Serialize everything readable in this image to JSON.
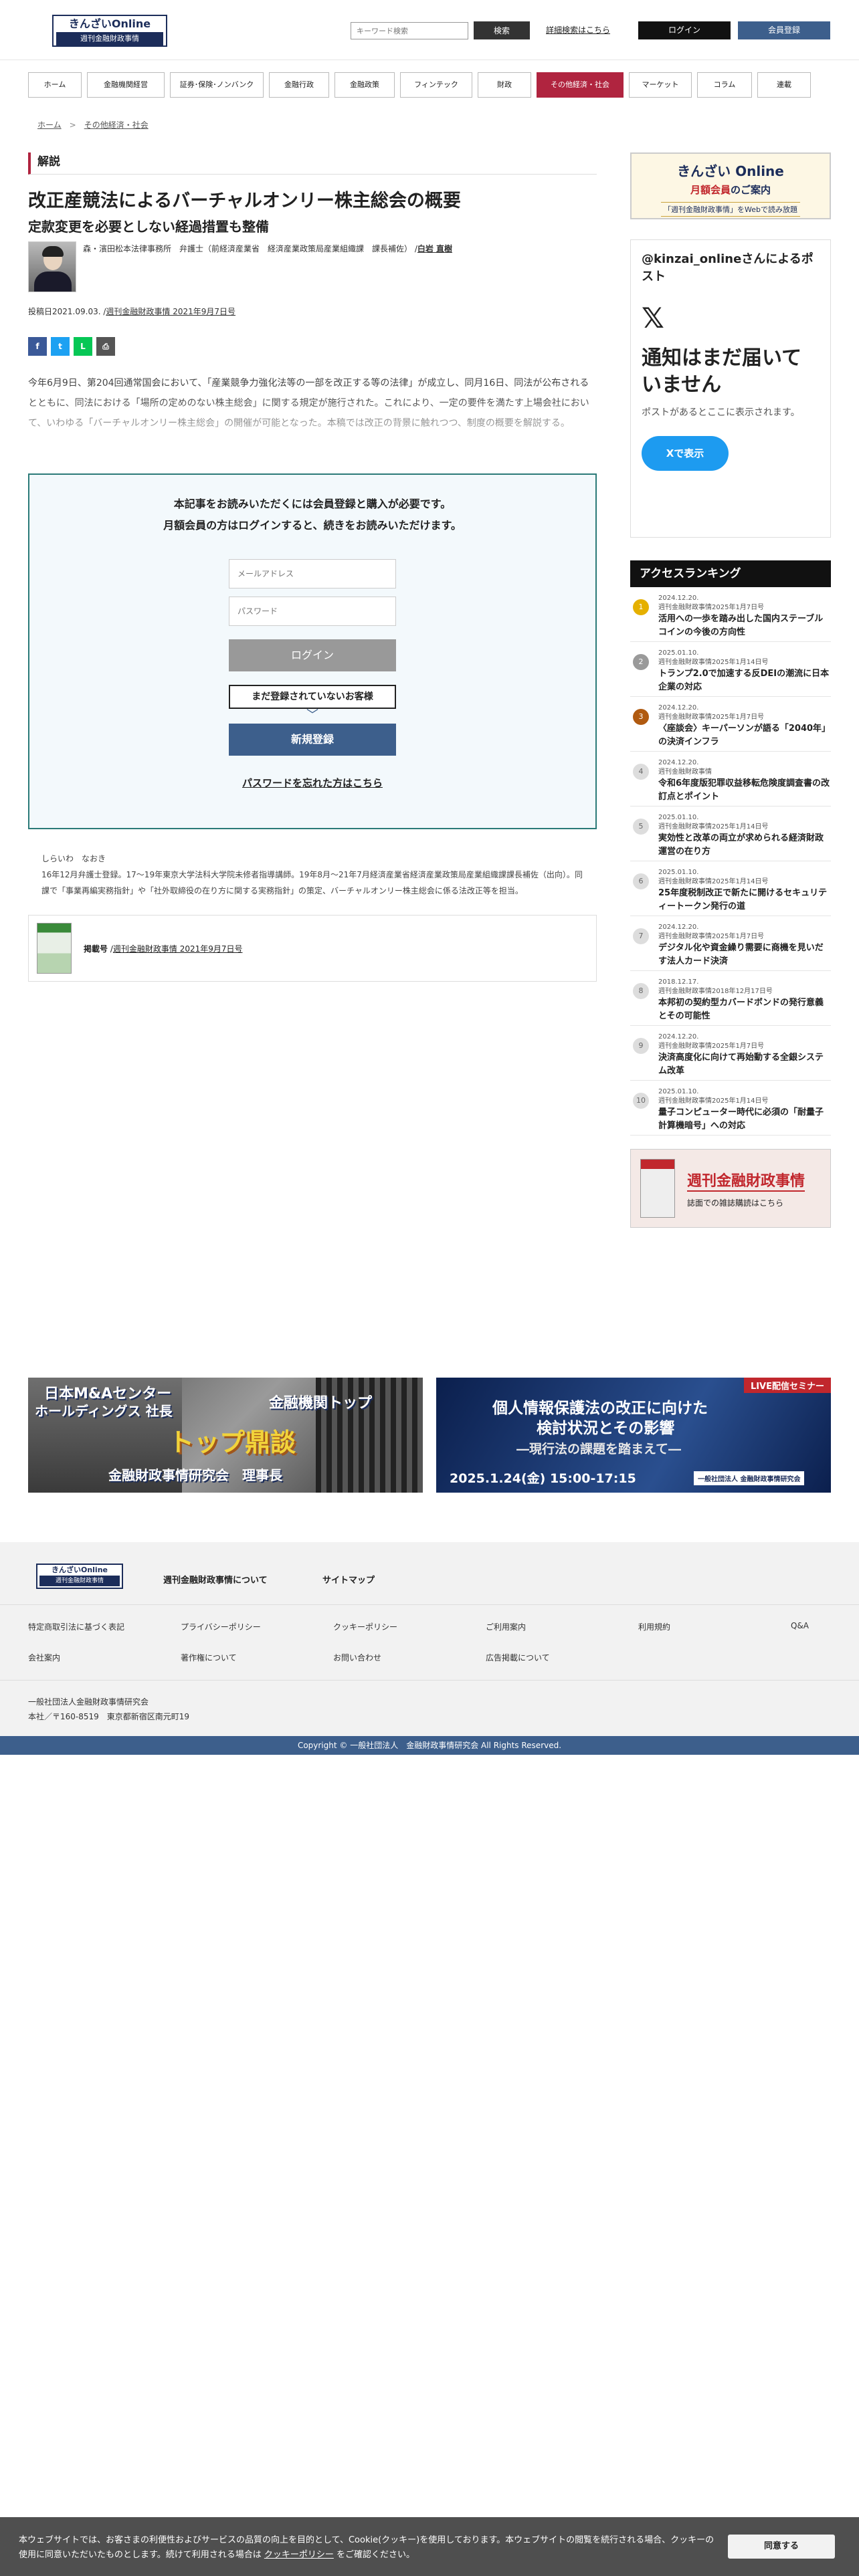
{
  "header": {
    "logo_line1": "きんざいOnline",
    "logo_line2": "週刊金融財政事情",
    "search_placeholder": "キーワード検索",
    "search_button": "検索",
    "advanced_search": "詳細検索はこちら",
    "login": "ログイン",
    "register": "会員登録"
  },
  "nav": {
    "items": [
      {
        "label": "ホーム",
        "w": 80
      },
      {
        "label": "金融機関経営",
        "w": 116
      },
      {
        "label": "証券･保険･ノンバンク",
        "w": 140
      },
      {
        "label": "金融行政",
        "w": 90
      },
      {
        "label": "金融政策",
        "w": 90
      },
      {
        "label": "フィンテック",
        "w": 108
      },
      {
        "label": "財政",
        "w": 80
      },
      {
        "label": "その他経済・社会",
        "w": 130
      },
      {
        "label": "マーケット",
        "w": 94
      },
      {
        "label": "コラム",
        "w": 82
      },
      {
        "label": "連載",
        "w": 80
      }
    ],
    "active_index": 7
  },
  "breadcrumb": {
    "home": "ホーム",
    "current": "その他経済・社会"
  },
  "article": {
    "category": "解説",
    "title": "改正産競法によるバーチャルオンリー株主総会の概要",
    "subtitle": "定款変更を必要としない経過措置も整備",
    "author_affiliation": "森・濱田松本法律事務所　弁護士（前経済産業省　経済産業政策局産業組織課　課長補佐）",
    "author_sep": " /",
    "author_name": "白岩 直樹",
    "posted": "投稿日2021.09.03. /",
    "issue_link": "週刊金融財政事情 2021年9月7日号",
    "body": "今年6月9日、第204回通常国会において、「産業競争力強化法等の一部を改正する等の法律」が成立し、同月16日、同法が公布されるとともに、同法における「場所の定めのない株主総会」に関する規定が施行された。これにより、一定の要件を満たす上場会社において、いわゆる「バーチャルオンリー株主総会」の開催が可能となった。本稿では改正の背景に触れつつ、制度の概要を解説する。",
    "share": [
      {
        "name": "facebook",
        "glyph": "f",
        "color": "#3b5998"
      },
      {
        "name": "twitter",
        "glyph": "t",
        "color": "#1da1f2"
      },
      {
        "name": "line",
        "glyph": "L",
        "color": "#06c755"
      },
      {
        "name": "print",
        "glyph": "⎙",
        "color": "#555555"
      }
    ]
  },
  "paywall": {
    "message1": "本記事をお読みいただくには会員登録と購入が必要です。",
    "message2": "月額会員の方はログインすると、続きをお読みいただけます。",
    "email_placeholder": "メールアドレス",
    "password_placeholder": "パスワード",
    "login": "ログイン",
    "not_registered": "まだ登録されていないお客様",
    "register": "新規登録",
    "forgot": "パスワードを忘れた方はこちら"
  },
  "bio": {
    "kana": "しらいわ　なおき",
    "text": "16年12月弁護士登録。17～19年東京大学法科大学院未修者指導講師。19年8月～21年7月経済産業省経済産業政策局産業組織課課長補佐（出向）。同課で「事業再編実務指針」や「社外取締役の在り方に関する実務指針」の策定、バーチャルオンリー株主総会に係る法改正等を担当。"
  },
  "publication": {
    "label": "掲載号",
    "sep": " /",
    "link": "週刊金融財政事情 2021年9月7日号"
  },
  "sidebar": {
    "banner_t1": "きんざい Online",
    "banner_t2a": "月額会員",
    "banner_t2b": "のご案内",
    "banner_t3": "「週刊金融財政事情」をWebで読み放題",
    "x_title": "@kinzai_onlineさんによるポスト",
    "x_logo": "𝕏",
    "x_heading": "通知はまだ届いていません",
    "x_text": "ポストがあるとここに表示されます。",
    "x_button": "Xで表示",
    "ranking_title": "アクセスランキング",
    "ranking": [
      {
        "num": "1",
        "date": "2024.12.20.",
        "issue": "週刊金融財政事情2025年1月7日号",
        "title": "活用への一歩を踏み出した国内ステーブルコインの今後の方向性"
      },
      {
        "num": "2",
        "date": "2025.01.10.",
        "issue": "週刊金融財政事情2025年1月14日号",
        "title": "トランプ2.0で加速する反DEIの潮流に日本企業の対応"
      },
      {
        "num": "3",
        "date": "2024.12.20.",
        "issue": "週刊金融財政事情2025年1月7日号",
        "title": "〈座談会〉キーパーソンが語る「2040年」の決済インフラ"
      },
      {
        "num": "4",
        "date": "2024.12.20.",
        "issue": "週刊金融財政事情",
        "title": "令和6年度版犯罪収益移転危険度調査書の改訂点とポイント"
      },
      {
        "num": "5",
        "date": "2025.01.10.",
        "issue": "週刊金融財政事情2025年1月14日号",
        "title": "実効性と改革の両立が求められる経済財政運営の在り方"
      },
      {
        "num": "6",
        "date": "2025.01.10.",
        "issue": "週刊金融財政事情2025年1月14日号",
        "title": "25年度税制改正で新たに開けるセキュリティートークン発行の道"
      },
      {
        "num": "7",
        "date": "2024.12.20.",
        "issue": "週刊金融財政事情2025年1月7日号",
        "title": "デジタル化や資金繰り需要に商機を見いだす法人カード決済"
      },
      {
        "num": "8",
        "date": "2018.12.17.",
        "issue": "週刊金融財政事情2018年12月17日号",
        "title": "本邦初の契約型カバードボンドの発行意義とその可能性"
      },
      {
        "num": "9",
        "date": "2024.12.20.",
        "issue": "週刊金融財政事情2025年1月7日号",
        "title": "決済高度化に向けて再始動する全銀システム改革"
      },
      {
        "num": "10",
        "date": "2025.01.10.",
        "issue": "週刊金融財政事情2025年1月14日号",
        "title": "量子コンピューター時代に必須の「耐量子計算機暗号」への対応"
      }
    ],
    "ad_big": "週刊金融財政事情",
    "ad_small": "誌面での雑誌購読はこちら"
  },
  "promos": {
    "p1_line1": "日本M&Aセンター",
    "p1_line2": "ホールディングス 社長",
    "p1_line3": "金融機関トップ",
    "p1_line4": "トップ鼎談",
    "p1_line5": "金融財政事情研究会　理事長",
    "p2_tag": "LIVE配信セミナー",
    "p2_line1": "個人情報保護法の改正に向けた",
    "p2_line2": "検討状況とその影響",
    "p2_line3": "―現行法の課題を踏まえて―",
    "p2_line4": "2025.1.24(金) 15:00-17:15",
    "p2_org": "一般社団法人 金融財政事情研究会"
  },
  "footer": {
    "logo_line1": "きんざいOnline",
    "logo_line2": "週刊金融財政事情",
    "about": "週刊金融財政事情について",
    "sitemap": "サイトマップ",
    "row1": [
      "特定商取引法に基づく表記",
      "プライバシーポリシー",
      "クッキーポリシー",
      "ご利用案内",
      "利用規約",
      "Q&A"
    ],
    "row2": [
      "会社案内",
      "著作権について",
      "お問い合わせ",
      "広告掲載について"
    ],
    "org": "一般社団法人金融財政事情研究会",
    "address": "本社／〒160-8519　東京都新宿区南元町19",
    "copyright": "Copyright © 一般社団法人　金融財政事情研究会 All Rights Reserved."
  },
  "cookie": {
    "text1": "本ウェブサイトでは、お客さまの利便性およびサービスの品質の向上を目的として、Cookie(クッキー)を使用しております。本ウェブサイトの閲覧を続行される場合、クッキーの使用に同意いただいたものとします。続けて利用される場合は ",
    "link": "クッキーポリシー",
    "text2": " をご確認ください。",
    "button": "同意する"
  }
}
